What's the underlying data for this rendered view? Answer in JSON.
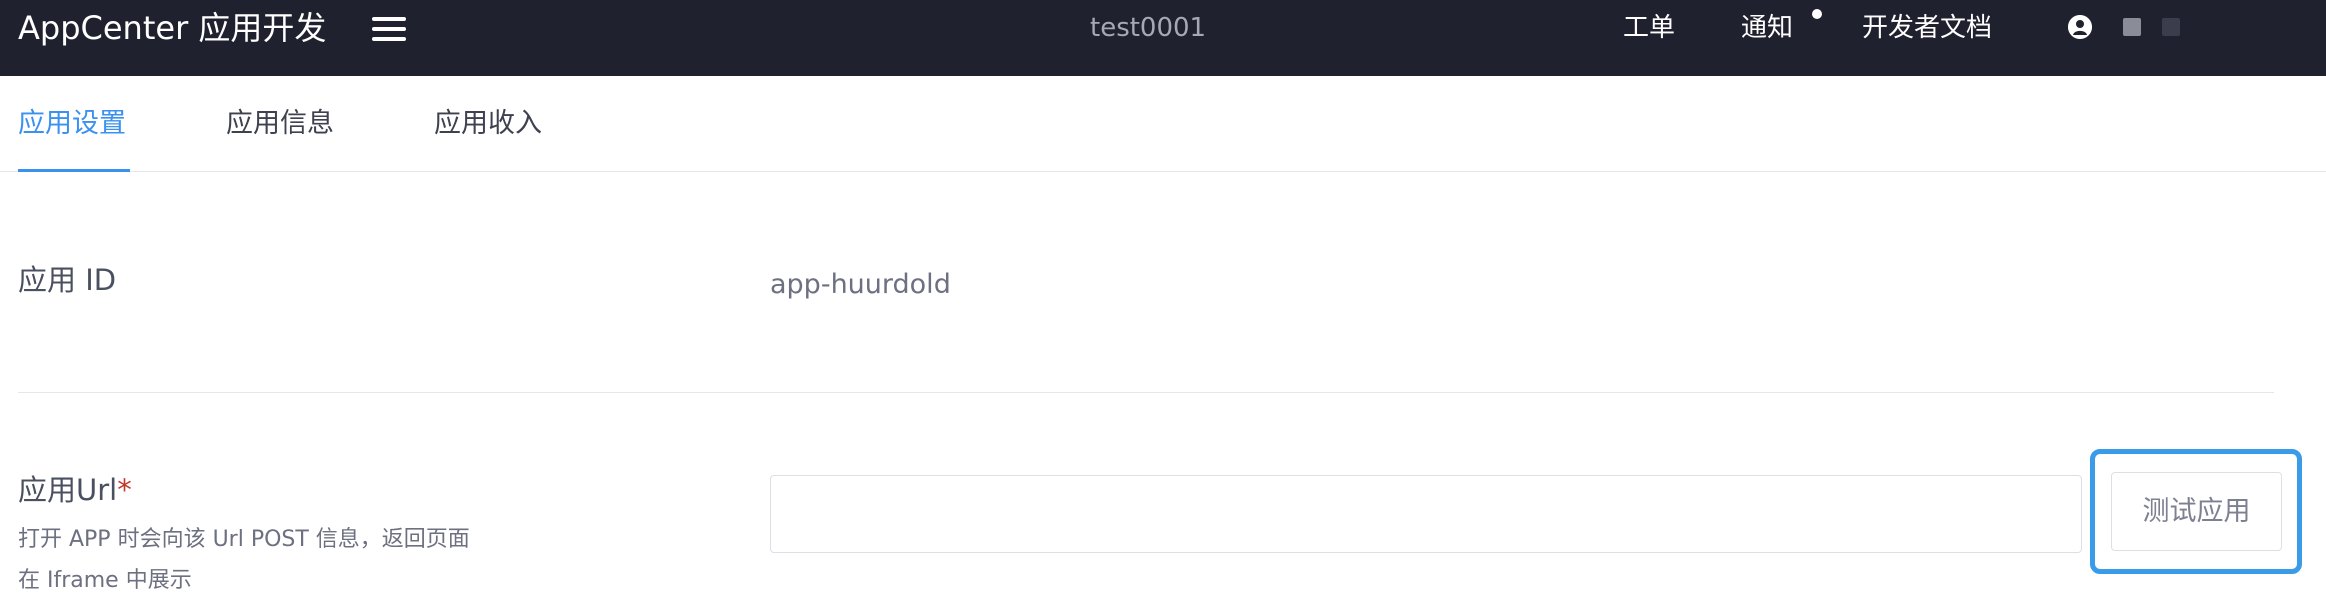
{
  "header": {
    "brand": "AppCenter 应用开发",
    "project_name": "test0001",
    "nav": {
      "ticket": "工单",
      "notice": "通知",
      "docs": "开发者文档"
    },
    "icons": [
      "menu-icon",
      "notification-dot-icon",
      "user-icon",
      "square-icon",
      "square-icon"
    ]
  },
  "tabs": [
    {
      "label": "应用设置",
      "active": true
    },
    {
      "label": "应用信息",
      "active": false
    },
    {
      "label": "应用收入",
      "active": false
    }
  ],
  "form": {
    "app_id": {
      "label": "应用 ID",
      "value": "app-huurdold"
    },
    "app_url": {
      "label": "应用Url",
      "required_mark": "*",
      "help_line_1": "打开 APP 时会向该 Url POST 信息，返回页面",
      "help_line_2": "在 Iframe 中展示",
      "value": "",
      "test_button": "测试应用"
    }
  },
  "colors": {
    "header_bg": "#20212f",
    "accent": "#3a91f0",
    "focus_ring": "#3a9ce8",
    "required": "#c0392b"
  }
}
